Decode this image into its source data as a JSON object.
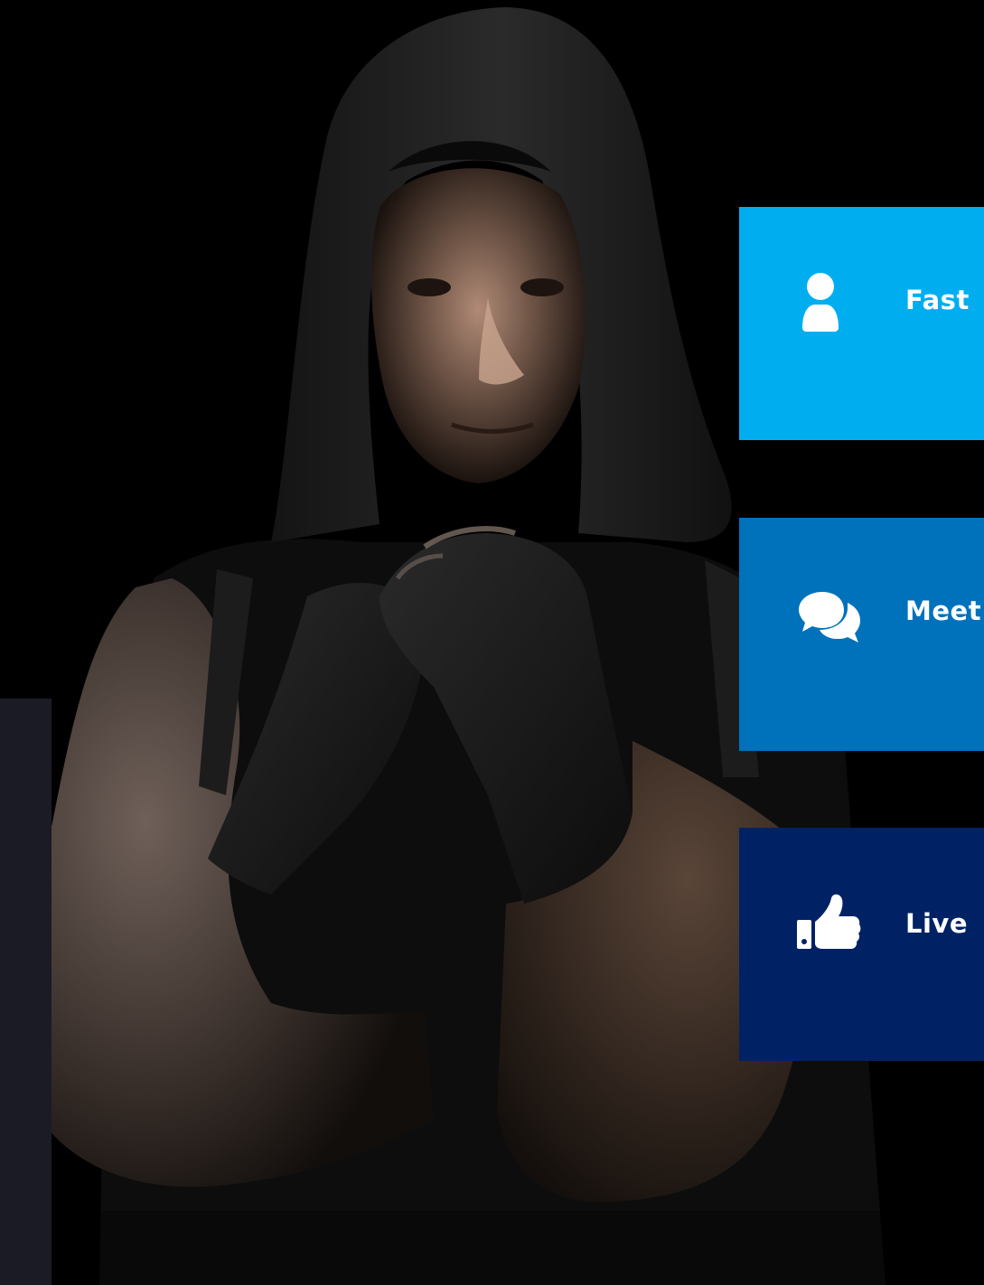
{
  "hero_image": {
    "description_icon": "boxer-photo"
  },
  "colors": {
    "background": "#000000",
    "side_panel": "#1b1b25",
    "card_1": "#00aeef",
    "card_2": "#0072bc",
    "card_3": "#002264",
    "text": "#ffffff"
  },
  "features": [
    {
      "title": "Fast",
      "icon": "user-icon",
      "color": "#00aeef"
    },
    {
      "title": "Meet",
      "icon": "comments-icon",
      "color": "#0072bc"
    },
    {
      "title": "Live",
      "icon": "thumbs-up-icon",
      "color": "#002264"
    }
  ]
}
